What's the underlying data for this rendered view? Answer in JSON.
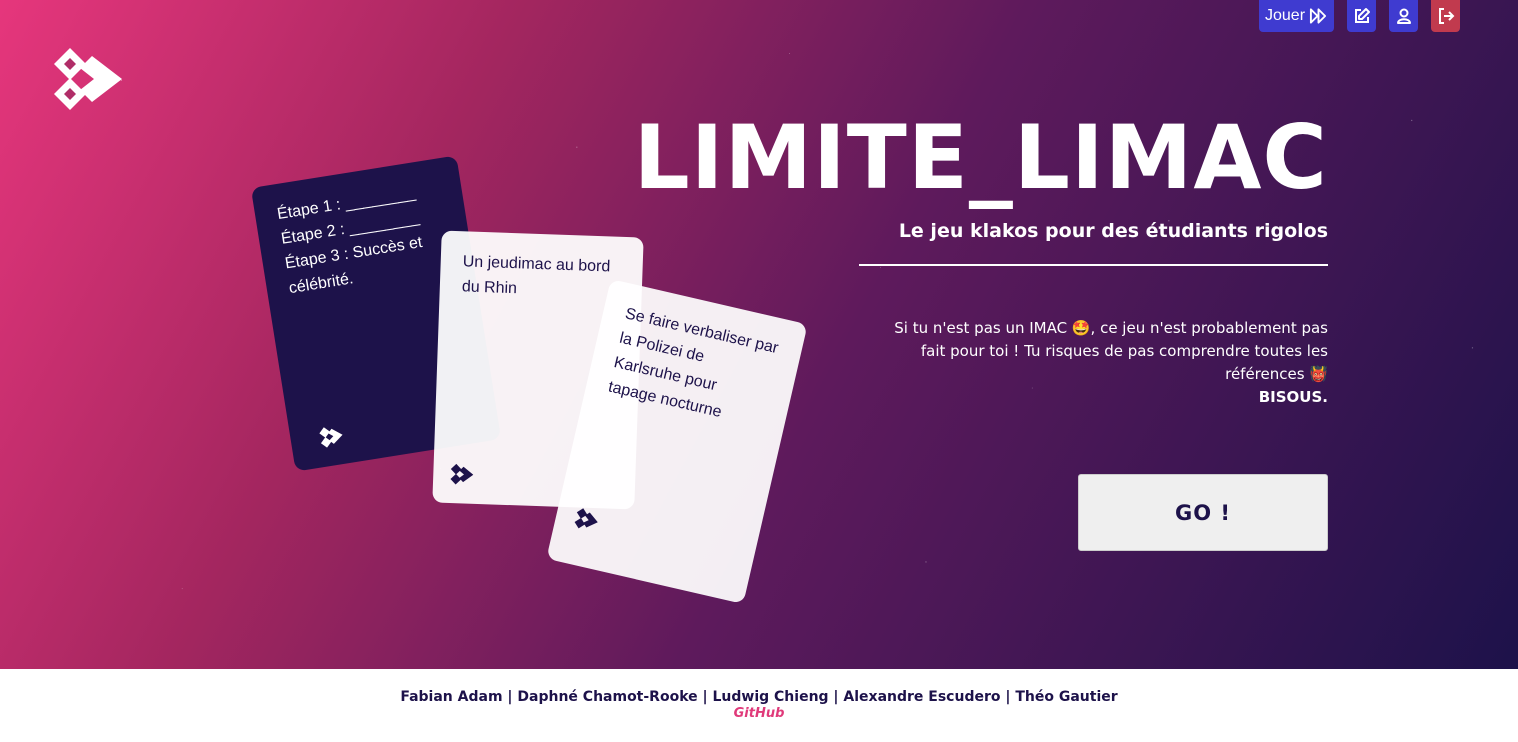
{
  "nav": {
    "play_label": "Jouer",
    "play_icon": "fast-forward-icon",
    "edit_icon": "edit-icon",
    "account_icon": "user-icon",
    "logout_icon": "logout-icon",
    "accent": "#3f3bd0",
    "logout_color": "#c13a4e"
  },
  "hero": {
    "title": "LIMITE_LIMAC",
    "subtitle": "Le jeu klakos pour des étudiants rigolos",
    "description": "Si tu n'est pas un IMAC 🤩, ce jeu n'est probablement pas fait pour toi ! Tu risques de pas comprendre toutes les références 👹",
    "description_bold": "BISOUS.",
    "go_button": "GO !"
  },
  "cards": {
    "dark": {
      "lines": [
        "Étape 1 : ________",
        "Étape 2 : ________",
        "Étape 3 : Succès et célébrité."
      ]
    },
    "white_1": {
      "text": "Un jeudimac au bord du Rhin"
    },
    "white_2": {
      "text": "Se faire verbaliser par la Polizei de Karlsruhe pour tapage nocturne"
    }
  },
  "footer": {
    "credits": "Fabian Adam | Daphné Chamot-Rooke | Ludwig Chieng | Alexandre Escudero | Théo Gautier",
    "github": "GitHub"
  },
  "colors": {
    "gradient_start": "#e6367c",
    "gradient_end": "#1d124a",
    "dark_card": "#1d124a",
    "github_link": "#e03a7a"
  }
}
